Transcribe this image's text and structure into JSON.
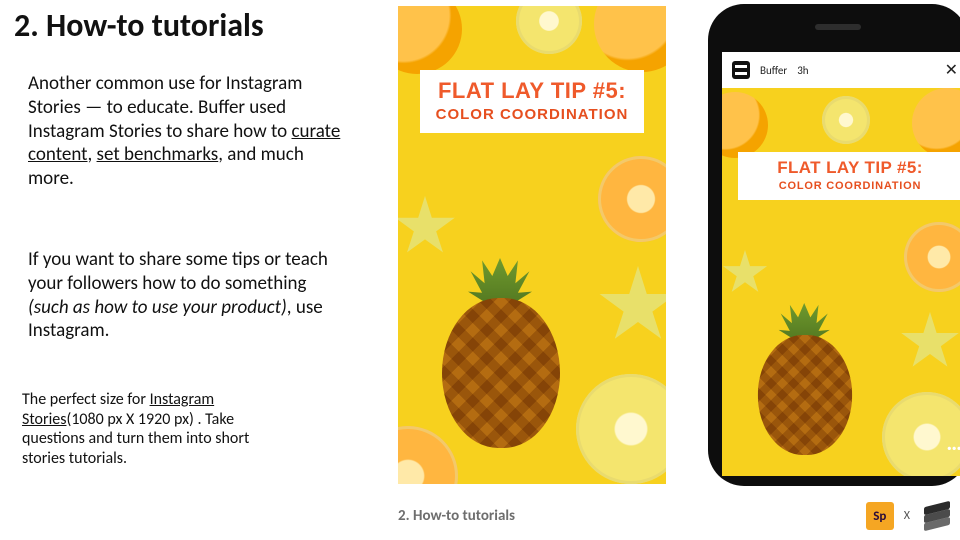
{
  "heading": "2. How-to tutorials",
  "para1_a": "Another common use for Instagram Stories — to educate. Buffer used Instagram Stories to share how to ",
  "para1_link1": "curate content",
  "para1_b": ", ",
  "para1_link2": "set benchmarks",
  "para1_c": ", and much more.",
  "para2_a": "If you want to share some tips or teach your followers how to do something ",
  "para2_i": "(such as how to use your product)",
  "para2_b": ", use Instagram.",
  "notes_a": "The perfect size for ",
  "notes_link": "Instagram Stories",
  "notes_b": "(1080 px X 1920 px) . Take questions and turn them into short stories tutorials.",
  "story": {
    "tip_line1": "FLAT LAY TIP #5:",
    "tip_line2": "COLOR COORDINATION"
  },
  "phone": {
    "account": "Buffer",
    "time": "3h",
    "tip_line1": "FLAT LAY TIP #5:",
    "tip_line2": "COLOR COORDINATION",
    "more": "…"
  },
  "footer": {
    "caption": "2. How-to tutorials",
    "badge": "Sp",
    "close": "X"
  }
}
